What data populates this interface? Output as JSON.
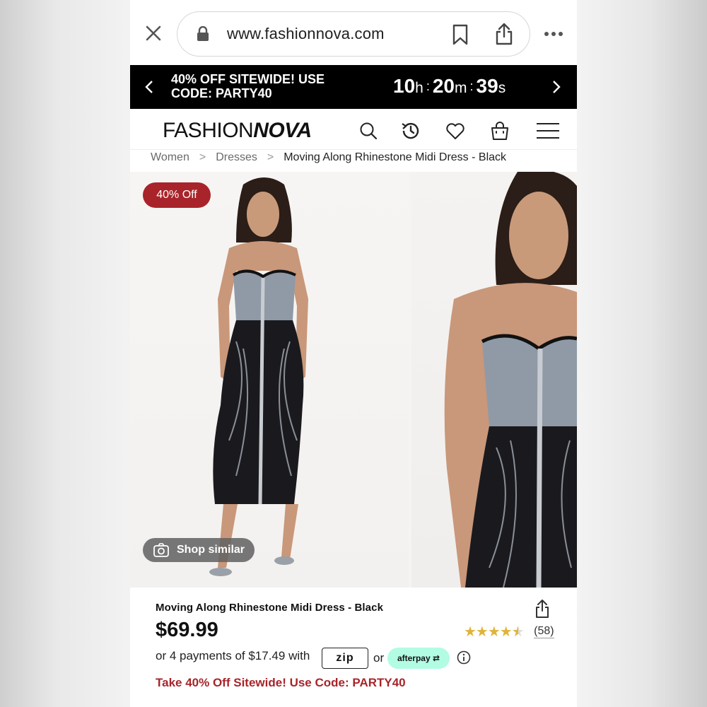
{
  "browser": {
    "url": "www.fashionnova.com"
  },
  "promo_banner": {
    "text": "40% OFF SITEWIDE! USE CODE: PARTY40",
    "timer": {
      "hours": "10",
      "hours_unit": "h",
      "minutes": "20",
      "minutes_unit": "m",
      "seconds": "39",
      "seconds_unit": "s",
      "separator": ":"
    }
  },
  "header": {
    "logo_light": "FASHION",
    "logo_bold": "NOVA",
    "icons": [
      "search-icon",
      "history-icon",
      "heart-icon",
      "shopping-bag-icon",
      "menu-icon"
    ]
  },
  "breadcrumb": {
    "items": [
      "Women",
      "Dresses"
    ],
    "separator": ">",
    "current": "Moving Along Rhinestone Midi Dress - Black"
  },
  "gallery": {
    "discount_badge": "40% Off",
    "shop_similar": "Shop similar"
  },
  "product": {
    "title": "Moving Along Rhinestone Midi Dress - Black",
    "price": "$69.99",
    "rating": 4.5,
    "review_count": "(58)",
    "payments_text": "or 4 payments of $17.49 with",
    "zip_label": "zip",
    "or_text": "or",
    "afterpay_label": "afterpay",
    "promo_text": "Take 40% Off Sitewide! Use Code: PARTY40"
  },
  "colors": {
    "accent_red": "#a8242a",
    "banner_black": "#000000",
    "star_gold": "#e0b43a",
    "afterpay_mint": "#b2fce4"
  }
}
